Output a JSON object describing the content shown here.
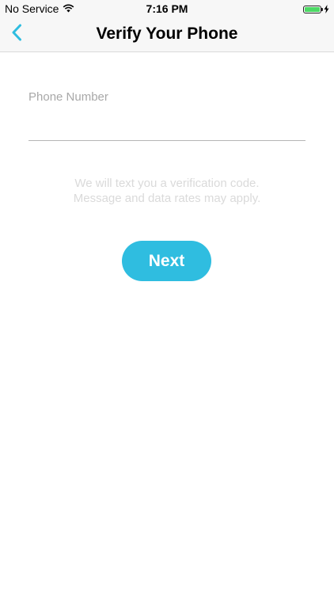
{
  "status_bar": {
    "carrier": "No Service",
    "time": "7:16 PM",
    "battery_level": 1.0,
    "battery_color": "#4cd964",
    "wifi_icon": "wifi-icon",
    "charging_icon": "bolt-icon"
  },
  "nav": {
    "title": "Verify Your Phone",
    "back_icon": "chevron-left-icon",
    "accent_color": "#2fbde0"
  },
  "form": {
    "phone_label": "Phone Number",
    "phone_value": "",
    "hint_line1": "We will text you a verification code.",
    "hint_line2": "Message and data rates may apply."
  },
  "actions": {
    "next_label": "Next",
    "next_color": "#2fbde0"
  }
}
